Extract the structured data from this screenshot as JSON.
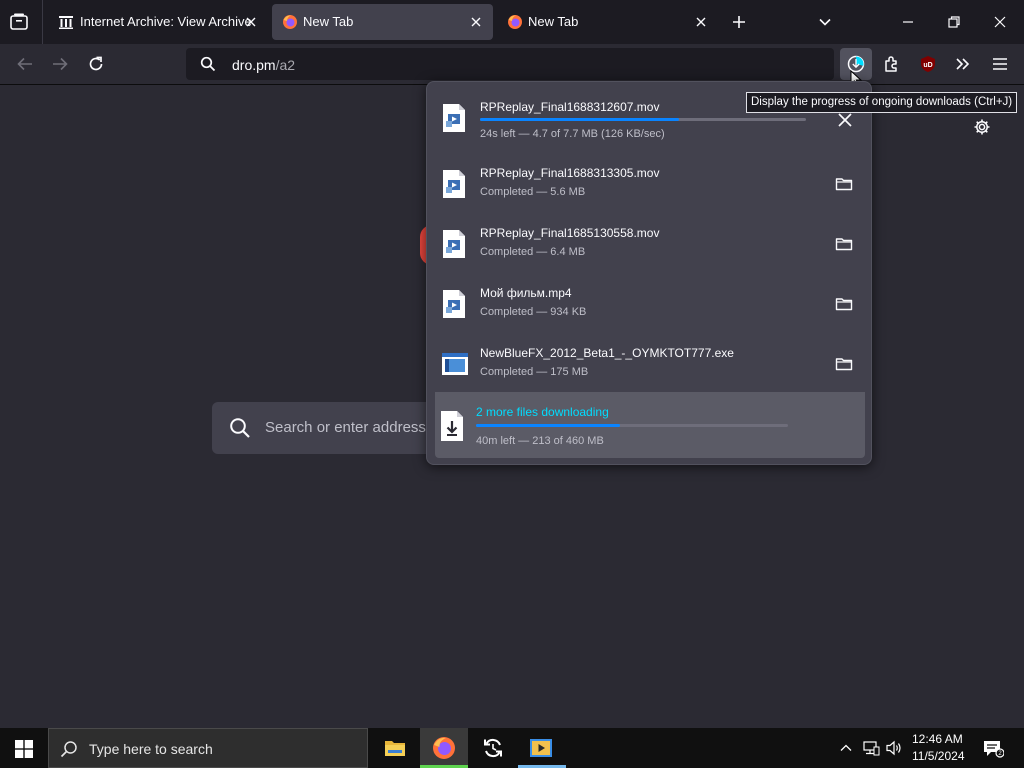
{
  "tabs": [
    {
      "title": "Internet Archive: View Archive",
      "active": false,
      "favicon": "archive-icon"
    },
    {
      "title": "New Tab",
      "active": true,
      "favicon": "firefox-icon"
    },
    {
      "title": "New Tab",
      "active": false,
      "favicon": "firefox-icon"
    }
  ],
  "urlbar": {
    "host": "dro.pm",
    "path": "/a2"
  },
  "page": {
    "search_placeholder": "Search or enter address"
  },
  "tooltip": "Display the progress of ongoing downloads (Ctrl+J)",
  "downloads": [
    {
      "name": "RPReplay_Final1688312607.mov",
      "status": "24s left — 4.7 of 7.7 MB (126 KB/sec)",
      "progress": 0.61,
      "action": "cancel-icon",
      "file_icon": "video-file-icon"
    },
    {
      "name": "RPReplay_Final1688313305.mov",
      "status": "Completed — 5.6 MB",
      "action": "folder-icon",
      "file_icon": "video-file-icon"
    },
    {
      "name": "RPReplay_Final1685130558.mov",
      "status": "Completed — 6.4 MB",
      "action": "folder-icon",
      "file_icon": "video-file-icon"
    },
    {
      "name": "Мой фильм.mp4",
      "status": "Completed — 934 KB",
      "action": "folder-icon",
      "file_icon": "video-file-icon"
    },
    {
      "name": "NewBlueFX_2012_Beta1_-_OYMKTOT777.exe",
      "status": "Completed — 175 MB",
      "action": "folder-icon",
      "file_icon": "exe-file-icon"
    }
  ],
  "summary": {
    "title": "2 more files downloading",
    "status": "40m left — 213 of 460 MB",
    "progress": 0.46,
    "icon": "download-arrow-icon"
  },
  "taskbar": {
    "search_placeholder": "Type here to search",
    "time": "12:46 AM",
    "date": "11/5/2024",
    "apps": [
      "file-explorer-icon",
      "firefox-icon",
      "sync-app-icon",
      "media-player-icon"
    ]
  },
  "colors": {
    "accent": "#0a84ff",
    "link": "#00ddff",
    "panel": "#42414d",
    "toolbar": "#2b2a33"
  }
}
